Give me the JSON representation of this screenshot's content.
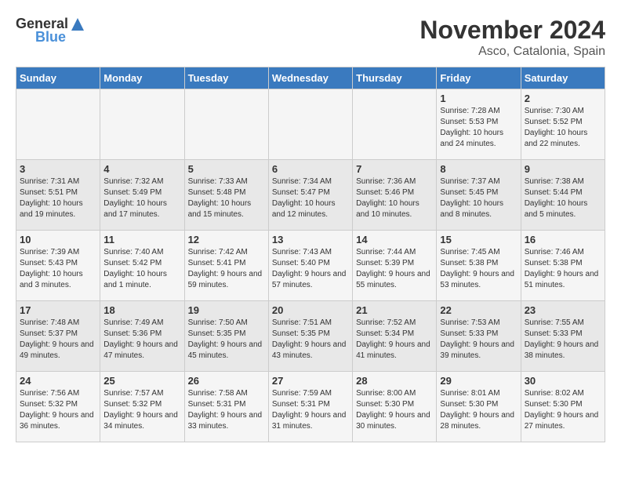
{
  "header": {
    "logo_general": "General",
    "logo_blue": "Blue",
    "month": "November 2024",
    "location": "Asco, Catalonia, Spain"
  },
  "days_of_week": [
    "Sunday",
    "Monday",
    "Tuesday",
    "Wednesday",
    "Thursday",
    "Friday",
    "Saturday"
  ],
  "weeks": [
    [
      {
        "day": "",
        "info": ""
      },
      {
        "day": "",
        "info": ""
      },
      {
        "day": "",
        "info": ""
      },
      {
        "day": "",
        "info": ""
      },
      {
        "day": "",
        "info": ""
      },
      {
        "day": "1",
        "info": "Sunrise: 7:28 AM\nSunset: 5:53 PM\nDaylight: 10 hours and 24 minutes."
      },
      {
        "day": "2",
        "info": "Sunrise: 7:30 AM\nSunset: 5:52 PM\nDaylight: 10 hours and 22 minutes."
      }
    ],
    [
      {
        "day": "3",
        "info": "Sunrise: 7:31 AM\nSunset: 5:51 PM\nDaylight: 10 hours and 19 minutes."
      },
      {
        "day": "4",
        "info": "Sunrise: 7:32 AM\nSunset: 5:49 PM\nDaylight: 10 hours and 17 minutes."
      },
      {
        "day": "5",
        "info": "Sunrise: 7:33 AM\nSunset: 5:48 PM\nDaylight: 10 hours and 15 minutes."
      },
      {
        "day": "6",
        "info": "Sunrise: 7:34 AM\nSunset: 5:47 PM\nDaylight: 10 hours and 12 minutes."
      },
      {
        "day": "7",
        "info": "Sunrise: 7:36 AM\nSunset: 5:46 PM\nDaylight: 10 hours and 10 minutes."
      },
      {
        "day": "8",
        "info": "Sunrise: 7:37 AM\nSunset: 5:45 PM\nDaylight: 10 hours and 8 minutes."
      },
      {
        "day": "9",
        "info": "Sunrise: 7:38 AM\nSunset: 5:44 PM\nDaylight: 10 hours and 5 minutes."
      }
    ],
    [
      {
        "day": "10",
        "info": "Sunrise: 7:39 AM\nSunset: 5:43 PM\nDaylight: 10 hours and 3 minutes."
      },
      {
        "day": "11",
        "info": "Sunrise: 7:40 AM\nSunset: 5:42 PM\nDaylight: 10 hours and 1 minute."
      },
      {
        "day": "12",
        "info": "Sunrise: 7:42 AM\nSunset: 5:41 PM\nDaylight: 9 hours and 59 minutes."
      },
      {
        "day": "13",
        "info": "Sunrise: 7:43 AM\nSunset: 5:40 PM\nDaylight: 9 hours and 57 minutes."
      },
      {
        "day": "14",
        "info": "Sunrise: 7:44 AM\nSunset: 5:39 PM\nDaylight: 9 hours and 55 minutes."
      },
      {
        "day": "15",
        "info": "Sunrise: 7:45 AM\nSunset: 5:38 PM\nDaylight: 9 hours and 53 minutes."
      },
      {
        "day": "16",
        "info": "Sunrise: 7:46 AM\nSunset: 5:38 PM\nDaylight: 9 hours and 51 minutes."
      }
    ],
    [
      {
        "day": "17",
        "info": "Sunrise: 7:48 AM\nSunset: 5:37 PM\nDaylight: 9 hours and 49 minutes."
      },
      {
        "day": "18",
        "info": "Sunrise: 7:49 AM\nSunset: 5:36 PM\nDaylight: 9 hours and 47 minutes."
      },
      {
        "day": "19",
        "info": "Sunrise: 7:50 AM\nSunset: 5:35 PM\nDaylight: 9 hours and 45 minutes."
      },
      {
        "day": "20",
        "info": "Sunrise: 7:51 AM\nSunset: 5:35 PM\nDaylight: 9 hours and 43 minutes."
      },
      {
        "day": "21",
        "info": "Sunrise: 7:52 AM\nSunset: 5:34 PM\nDaylight: 9 hours and 41 minutes."
      },
      {
        "day": "22",
        "info": "Sunrise: 7:53 AM\nSunset: 5:33 PM\nDaylight: 9 hours and 39 minutes."
      },
      {
        "day": "23",
        "info": "Sunrise: 7:55 AM\nSunset: 5:33 PM\nDaylight: 9 hours and 38 minutes."
      }
    ],
    [
      {
        "day": "24",
        "info": "Sunrise: 7:56 AM\nSunset: 5:32 PM\nDaylight: 9 hours and 36 minutes."
      },
      {
        "day": "25",
        "info": "Sunrise: 7:57 AM\nSunset: 5:32 PM\nDaylight: 9 hours and 34 minutes."
      },
      {
        "day": "26",
        "info": "Sunrise: 7:58 AM\nSunset: 5:31 PM\nDaylight: 9 hours and 33 minutes."
      },
      {
        "day": "27",
        "info": "Sunrise: 7:59 AM\nSunset: 5:31 PM\nDaylight: 9 hours and 31 minutes."
      },
      {
        "day": "28",
        "info": "Sunrise: 8:00 AM\nSunset: 5:30 PM\nDaylight: 9 hours and 30 minutes."
      },
      {
        "day": "29",
        "info": "Sunrise: 8:01 AM\nSunset: 5:30 PM\nDaylight: 9 hours and 28 minutes."
      },
      {
        "day": "30",
        "info": "Sunrise: 8:02 AM\nSunset: 5:30 PM\nDaylight: 9 hours and 27 minutes."
      }
    ]
  ]
}
